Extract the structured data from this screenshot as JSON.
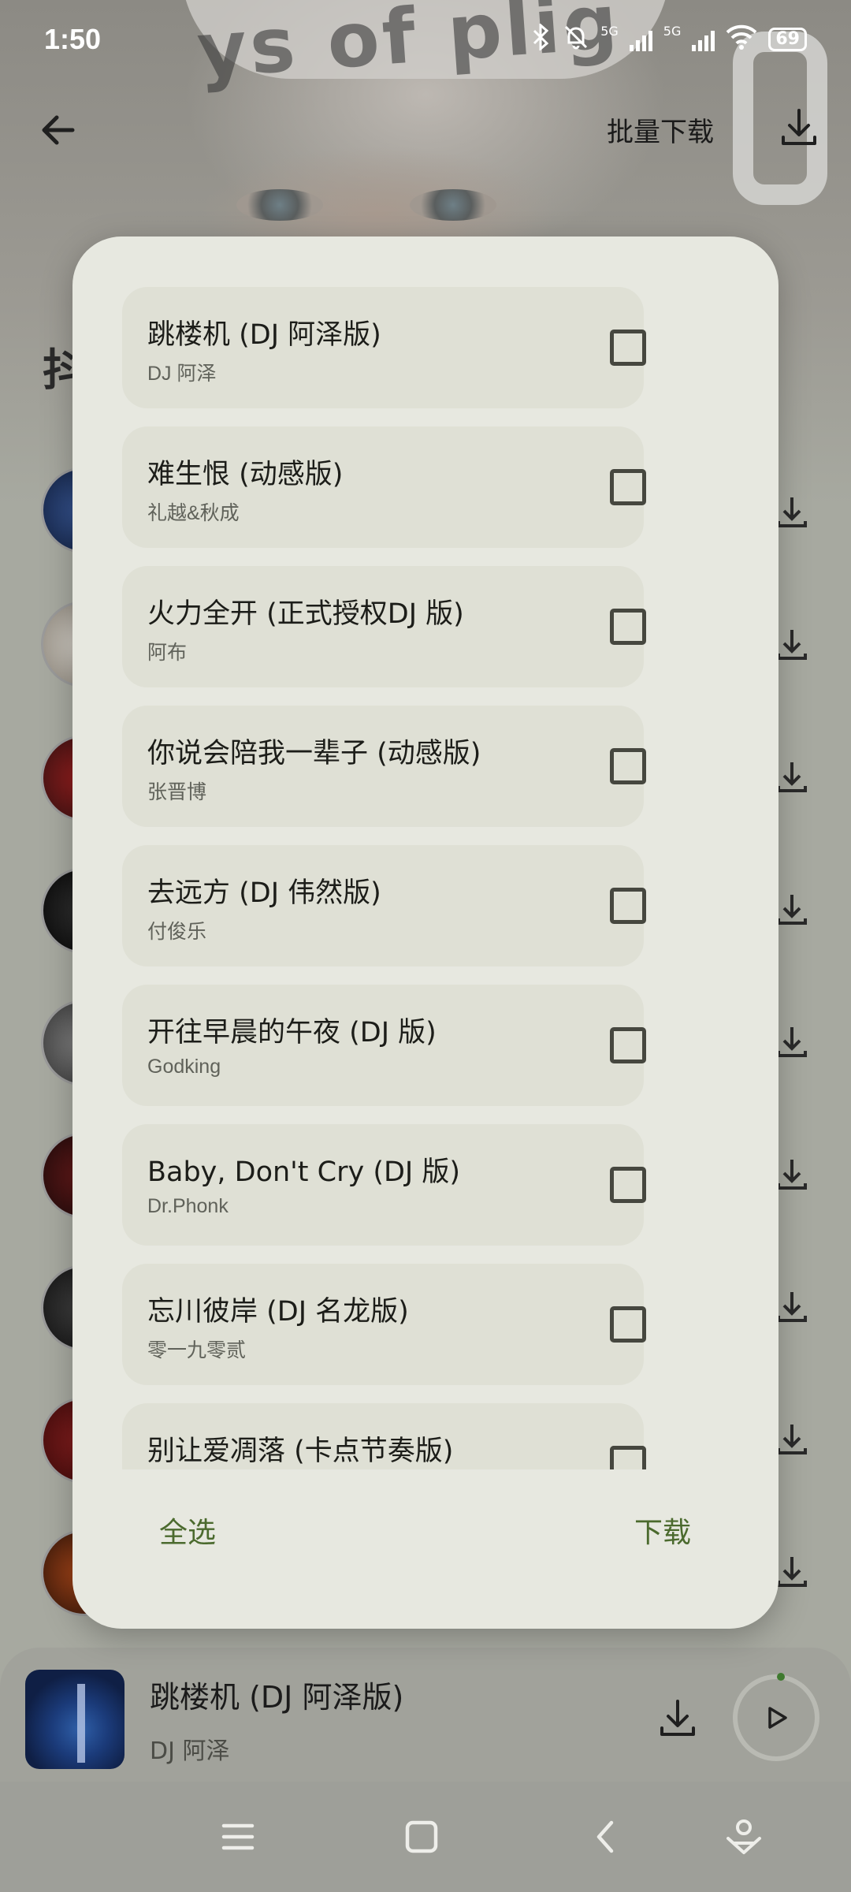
{
  "status_bar": {
    "time": "1:50",
    "network_1": "5G",
    "network_2": "5G",
    "battery": "69"
  },
  "header": {
    "title": "批量下载",
    "section_char": "抖"
  },
  "dialog": {
    "songs": [
      {
        "title": "跳楼机 (DJ 阿泽版)",
        "artist": "DJ 阿泽",
        "checked": false
      },
      {
        "title": "难生恨 (动感版)",
        "artist": "礼越&秋成",
        "checked": false
      },
      {
        "title": "火力全开 (正式授权DJ 版)",
        "artist": "阿布",
        "checked": false
      },
      {
        "title": "你说会陪我一辈子 (动感版)",
        "artist": "张晋博",
        "checked": false
      },
      {
        "title": "去远方 (DJ 伟然版)",
        "artist": "付俊乐",
        "checked": false
      },
      {
        "title": "开往早晨的午夜 (DJ 版)",
        "artist": "Godking",
        "checked": false
      },
      {
        "title": "Baby, Don't Cry (DJ 版)",
        "artist": "Dr.Phonk",
        "checked": false
      },
      {
        "title": "忘川彼岸 (DJ 名龙版)",
        "artist": "零一九零贰",
        "checked": false
      },
      {
        "title": "别让爱凋落 (卡点节奏版)",
        "artist": "",
        "checked": false
      }
    ],
    "select_all_label": "全选",
    "download_label": "下载"
  },
  "mini_player": {
    "title": "跳楼机 (DJ 阿泽版)",
    "artist": "DJ 阿泽"
  },
  "colors": {
    "dialog_bg": "#e7e8e0",
    "item_bg": "#dfe0d5",
    "accent": "#4b6a2e"
  }
}
